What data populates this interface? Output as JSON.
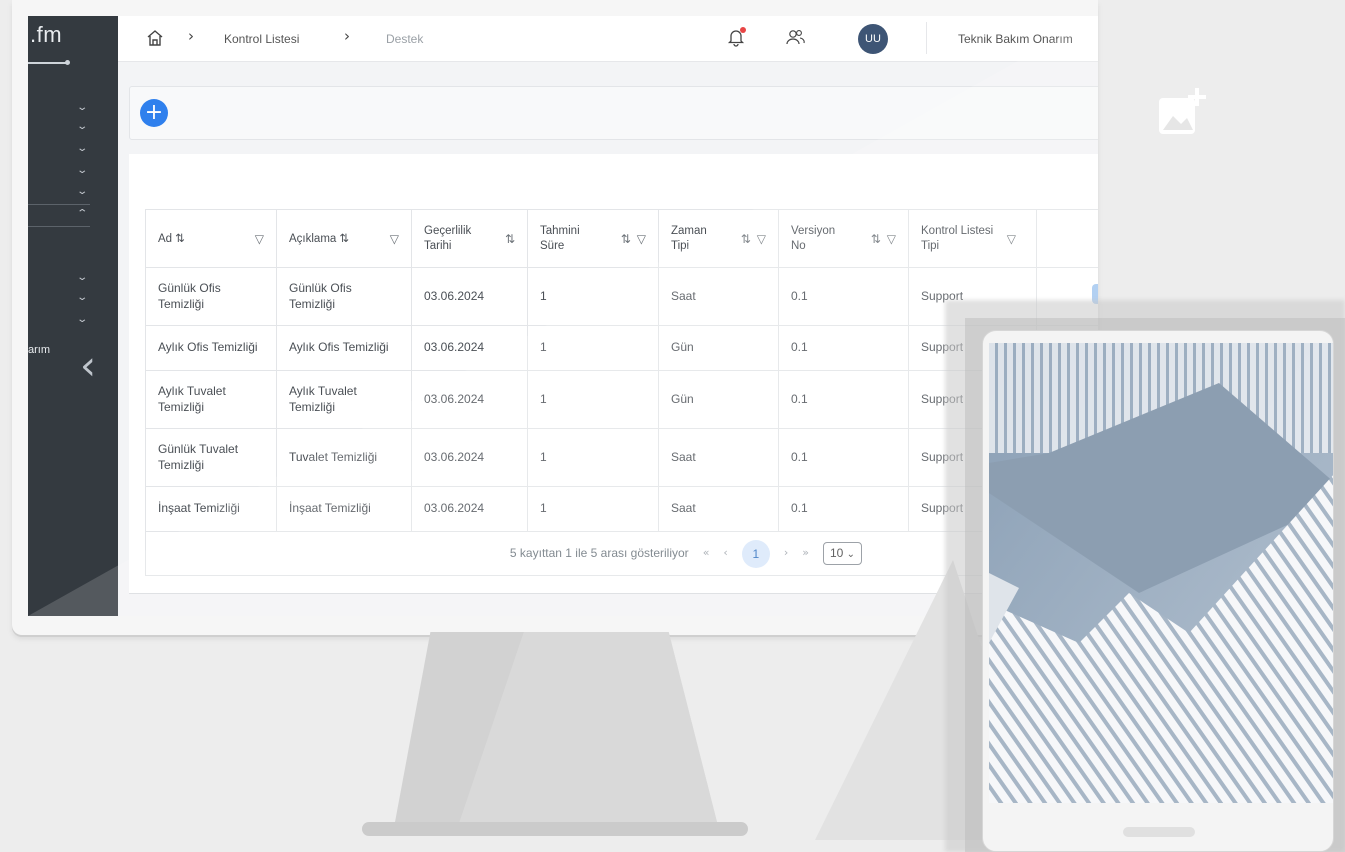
{
  "brand": {
    "text": ".fm"
  },
  "sidebar": {
    "partial_text": "arım",
    "collapse_icon": "chevron-left-icon"
  },
  "topbar": {
    "home_icon": "home-icon",
    "breadcrumb": [
      {
        "label": "Kontrol Listesi"
      },
      {
        "label": "Destek"
      }
    ],
    "notification_icon": "bell-icon",
    "users_icon": "users-icon",
    "avatar_initials": "UU",
    "user_name": "Teknik Bakım Onarım"
  },
  "toolbar": {
    "add_icon": "plus-icon"
  },
  "table": {
    "columns": [
      {
        "label": "Ad",
        "sortable": true,
        "filterable": true
      },
      {
        "label": "Açıklama",
        "sortable": true,
        "filterable": true
      },
      {
        "label": "Geçerlilik Tarihi",
        "sortable": true,
        "filterable": false
      },
      {
        "label": "Tahmini Süre",
        "sortable": true,
        "filterable": true
      },
      {
        "label": "Zaman Tipi",
        "sortable": true,
        "filterable": true
      },
      {
        "label": "Versiyon No",
        "sortable": true,
        "filterable": true
      },
      {
        "label": "Kontrol Listesi Tipi",
        "sortable": false,
        "filterable": true
      }
    ],
    "rows": [
      {
        "ad": "Günlük Ofis Temizliği",
        "aciklama": "Günlük Ofis Temizliği",
        "tarih": "03.06.2024",
        "sure": "1",
        "zaman": "Saat",
        "versiyon": "0.1",
        "tip": "Support"
      },
      {
        "ad": "Aylık Ofis Temizliği",
        "aciklama": "Aylık Ofis Temizliği",
        "tarih": "03.06.2024",
        "sure": "1",
        "zaman": "Gün",
        "versiyon": "0.1",
        "tip": "Support"
      },
      {
        "ad": "Aylık Tuvalet Temizliği",
        "aciklama": "Aylık Tuvalet Temizliği",
        "tarih": "03.06.2024",
        "sure": "1",
        "zaman": "Gün",
        "versiyon": "0.1",
        "tip": "Support"
      },
      {
        "ad": "Günlük Tuvalet Temizliği",
        "aciklama": "Tuvalet Temizliği",
        "tarih": "03.06.2024",
        "sure": "1",
        "zaman": "Saat",
        "versiyon": "0.1",
        "tip": "Support"
      },
      {
        "ad": "İnşaat Temizliği",
        "aciklama": "İnşaat Temizliği",
        "tarih": "03.06.2024",
        "sure": "1",
        "zaman": "Saat",
        "versiyon": "0.1",
        "tip": "Support"
      }
    ]
  },
  "pagination": {
    "summary": "5 kayıttan 1 ile 5 arası gösteriliyor",
    "first": "«",
    "prev": "‹",
    "current_page": "1",
    "next": "›",
    "last": "»",
    "rows_per_page": "10"
  },
  "colors": {
    "sidebar_bg": "#343a40",
    "accent": "#2f80ed",
    "avatar_bg": "#3e5575",
    "notification_dot": "#e84545"
  }
}
